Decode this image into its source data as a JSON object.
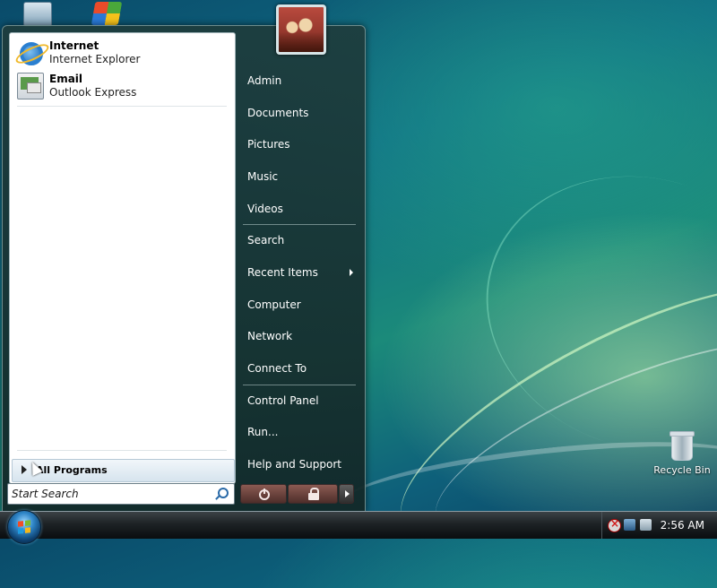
{
  "desktop": {
    "recycle_bin_label": "Recycle Bin"
  },
  "start_menu": {
    "pinned": [
      {
        "title": "Internet",
        "subtitle": "Internet Explorer",
        "icon": "internet-explorer-icon"
      },
      {
        "title": "Email",
        "subtitle": "Outlook Express",
        "icon": "outlook-express-icon"
      }
    ],
    "all_programs_label": "All Programs",
    "search_placeholder": "Start Search",
    "right_items": [
      "Admin",
      "Documents",
      "Pictures",
      "Music",
      "Videos",
      "Search",
      "Recent Items",
      "Computer",
      "Network",
      "Connect To",
      "Control Panel",
      "Run...",
      "Help and Support"
    ]
  },
  "taskbar": {
    "clock": "2:56 AM"
  },
  "colors": {
    "menu_panel": "#1e3c3c",
    "accent_blue": "#2f86c8"
  }
}
